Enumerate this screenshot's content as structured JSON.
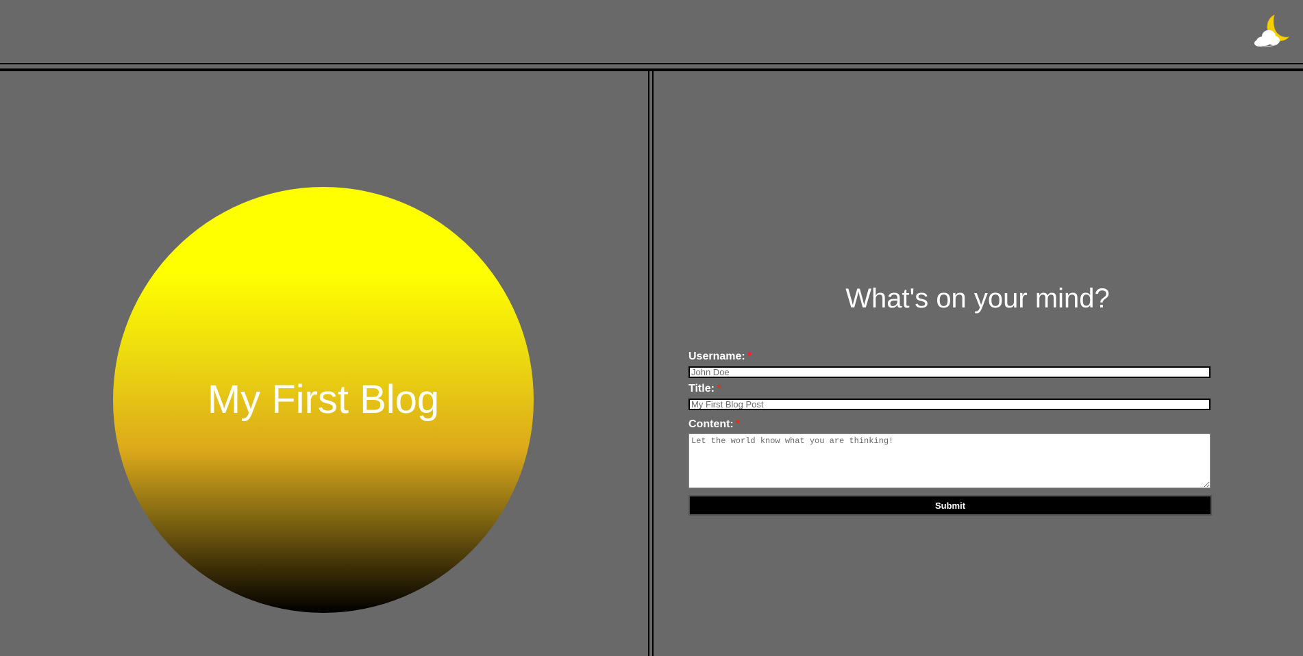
{
  "header": {
    "theme_toggle_icon": "moon-cloud-icon"
  },
  "hero": {
    "title": "My First Blog",
    "gradient_colors": [
      "#ffff00",
      "#dba81b",
      "#000000"
    ]
  },
  "form": {
    "heading": "What's on your mind?",
    "required_marker": "*",
    "username": {
      "label": "Username:",
      "placeholder": "John Doe"
    },
    "title": {
      "label": "Title:",
      "placeholder": "My First Blog Post"
    },
    "content": {
      "label": "Content:",
      "placeholder": "Let the world know what you are thinking!"
    },
    "submit_label": "Submit"
  },
  "colors": {
    "background": "#696969",
    "required": "#ff2020",
    "button": "#000000"
  }
}
